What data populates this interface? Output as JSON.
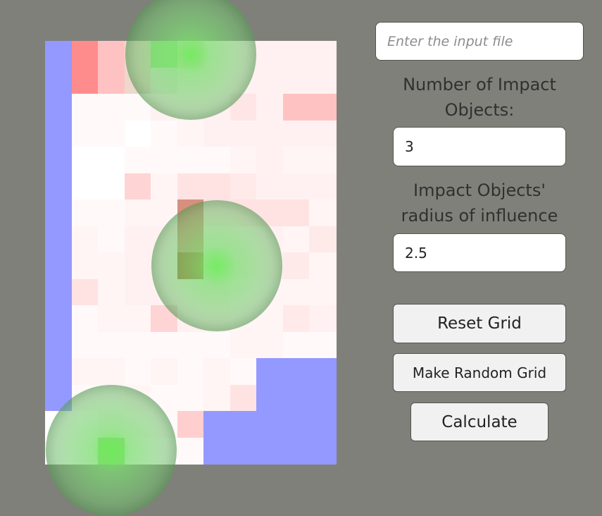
{
  "panel": {
    "input_file_placeholder": "Enter the input file",
    "num_objects_label": "Number of Impact Objects:",
    "num_objects_value": "3",
    "radius_label": "Impact Objects' radius of influence",
    "radius_value": "2.5",
    "reset_button": "Reset Grid",
    "random_button": "Make Random Grid",
    "calculate_button": "Calculate"
  },
  "grid": {
    "cols": 11,
    "rows": 16,
    "wall_color": "#9499ff",
    "cells": [
      [
        "W",
        "#ff8c8c",
        "#ffc2c2",
        "#efd7cd",
        "#8ff07a",
        "#ffdede",
        "#fff1f1",
        "#fff1f1",
        "#fff1f1",
        "#fff1f1",
        "#fff1f1"
      ],
      [
        "W",
        "#ff8c8c",
        "#ffc2c2",
        "#efd7cd",
        "#e8ecdf",
        "#fff1f1",
        "#fff1f1",
        "#fff1f1",
        "#fff1f1",
        "#fff1f1",
        "#fff1f1"
      ],
      [
        "W",
        "#fff9f9",
        "#fff9f9",
        "#fffafa",
        "#fff1f1",
        "#fff1f1",
        "#fff1f1",
        "#ffe6e6",
        "#fff1f1",
        "#ffc2c2",
        "#ffc2c2"
      ],
      [
        "W",
        "#fff9f9",
        "#fff9f9",
        "#ffffff",
        "#fff9f9",
        "#fff5f5",
        "#fff1f1",
        "#fff1f1",
        "#fff1f1",
        "#fff1f1",
        "#fff1f1"
      ],
      [
        "W",
        "#ffffff",
        "#ffffff",
        "#fff9f9",
        "#fff9f9",
        "#fff9f9",
        "#fff9f9",
        "#fff5f5",
        "#fff1f1",
        "#fff5f5",
        "#fff5f5"
      ],
      [
        "W",
        "#ffffff",
        "#ffffff",
        "#ffd4d4",
        "#fff5f5",
        "#ffe3e3",
        "#ffe3e3",
        "#ffe9e9",
        "#fff1f1",
        "#fff1f1",
        "#fff1f1"
      ],
      [
        "W",
        "#fff9f9",
        "#fff9f9",
        "#fff5f5",
        "#fff5f5",
        "#d6907d",
        "#ffe3e3",
        "#ffe3e3",
        "#ffe3e3",
        "#ffe3e3",
        "#fff5f5"
      ],
      [
        "W",
        "#fff5f5",
        "#fff9f9",
        "#fff1f1",
        "#fff1f1",
        "#d6907d",
        "#fff1f1",
        "#fff1f1",
        "#fff1f1",
        "#fff5f5",
        "#ffeaea"
      ],
      [
        "W",
        "#fff5f5",
        "#fff5f5",
        "#fff1f1",
        "#fff1f1",
        "#a8572a",
        "#fff1f1",
        "#fff1f1",
        "#fff1f1",
        "#ffeaea",
        "#fff5f5"
      ],
      [
        "W",
        "#ffe3e3",
        "#fff5f5",
        "#fff1f1",
        "#fff1f1",
        "#fff1f1",
        "#fff1f1",
        "#fff5f5",
        "#fff5f5",
        "#fff5f5",
        "#fff5f5"
      ],
      [
        "W",
        "#fff9f9",
        "#fff5f5",
        "#fff5f5",
        "#ffd4d4",
        "#fff1f1",
        "#fff1f1",
        "#fff5f5",
        "#fff5f5",
        "#ffe9e9",
        "#fff1f1"
      ],
      [
        "W",
        "#fff9f9",
        "#fff9f9",
        "#fff9f9",
        "#fff9f9",
        "#fff9f9",
        "#fff9f9",
        "#fff5f5",
        "#fff5f5",
        "#fff9f9",
        "#fff9f9"
      ],
      [
        "W",
        "#fff5f5",
        "#fff5f5",
        "#fff9f9",
        "#fff5f5",
        "#fff9f9",
        "#fff5f5",
        "#fff9f9",
        "W",
        "W",
        "W"
      ],
      [
        "W",
        "#fff9f9",
        "#fff9f9",
        "#fff5f5",
        "#fff9f9",
        "#fff9f9",
        "#fff5f5",
        "#ffe3e3",
        "W",
        "W",
        "W"
      ],
      [
        "#ffffff",
        "#ffffff",
        "#fff9f9",
        "#fffafa",
        "#fff9f9",
        "#ffcfcf",
        "W",
        "W",
        "W",
        "W",
        "W"
      ],
      [
        "#ffffff",
        "#ffffff",
        "#8fdc6a",
        "#ffffff",
        "#ffffff",
        "#fff9f9",
        "W",
        "W",
        "W",
        "W",
        "W"
      ]
    ],
    "impacts": [
      {
        "col": 5,
        "row": 0
      },
      {
        "col": 6,
        "row": 8
      },
      {
        "col": 2,
        "row": 15
      }
    ]
  }
}
